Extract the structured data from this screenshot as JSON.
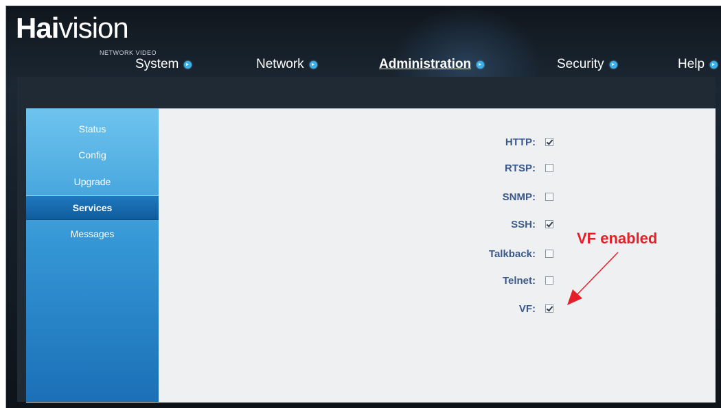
{
  "logo": {
    "brand_bold": "Hai",
    "brand_rest": "vision",
    "tagline": "NETWORK VIDEO"
  },
  "nav": {
    "items": [
      {
        "label": "System"
      },
      {
        "label": "Network"
      },
      {
        "label": "Administration"
      },
      {
        "label": "Security"
      },
      {
        "label": "Help"
      }
    ],
    "active": "Administration"
  },
  "sidebar": {
    "items": [
      {
        "label": "Status"
      },
      {
        "label": "Config"
      },
      {
        "label": "Upgrade"
      },
      {
        "label": "Services"
      },
      {
        "label": "Messages"
      }
    ],
    "active": "Services"
  },
  "services": [
    {
      "label": "HTTP:",
      "checked": true
    },
    {
      "label": "RTSP:",
      "checked": false
    },
    {
      "label": "SNMP:",
      "checked": false
    },
    {
      "label": "SSH:",
      "checked": true
    },
    {
      "label": "Talkback:",
      "checked": false
    },
    {
      "label": "Telnet:",
      "checked": false
    },
    {
      "label": "VF:",
      "checked": true
    }
  ],
  "annotation": {
    "text": "VF enabled",
    "color": "#e5202a"
  },
  "colors": {
    "accent": "#3ab0e8",
    "label": "#3b5a8a"
  }
}
